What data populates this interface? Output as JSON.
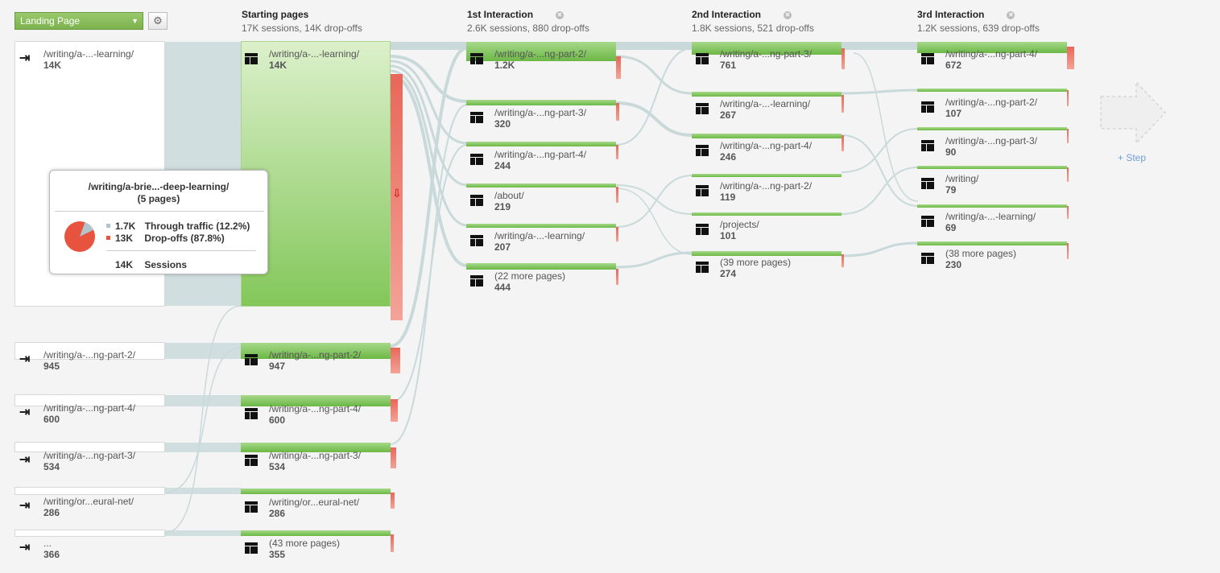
{
  "toolbar": {
    "dimension_select": "Landing Page",
    "settings_icon": "gear-icon"
  },
  "columns": [
    {
      "title": "Starting pages",
      "summary": "17K sessions, 14K drop-offs"
    },
    {
      "title": "1st Interaction",
      "summary": "2.6K sessions, 880 drop-offs"
    },
    {
      "title": "2nd Interaction",
      "summary": "1.8K sessions, 521 drop-offs"
    },
    {
      "title": "3rd Interaction",
      "summary": "1.2K sessions, 639 drop-offs"
    }
  ],
  "sources": [
    {
      "page": "/writing/a-...-learning/",
      "count": "14K"
    },
    {
      "page": "/writing/a-...ng-part-2/",
      "count": "945"
    },
    {
      "page": "/writing/a-...ng-part-4/",
      "count": "600"
    },
    {
      "page": "/writing/a-...ng-part-3/",
      "count": "534"
    },
    {
      "page": "/writing/or...eural-net/",
      "count": "286"
    },
    {
      "page": "...",
      "count": "366"
    }
  ],
  "starting_pages": [
    {
      "page": "/writing/a-...-learning/",
      "count": "14K"
    },
    {
      "page": "/writing/a-...ng-part-2/",
      "count": "947"
    },
    {
      "page": "/writing/a-...ng-part-4/",
      "count": "600"
    },
    {
      "page": "/writing/a-...ng-part-3/",
      "count": "534"
    },
    {
      "page": "/writing/or...eural-net/",
      "count": "286"
    },
    {
      "page": "(43 more pages)",
      "count": "355"
    }
  ],
  "interaction1": [
    {
      "page": "/writing/a-...ng-part-2/",
      "count": "1.2K"
    },
    {
      "page": "/writing/a-...ng-part-3/",
      "count": "320"
    },
    {
      "page": "/writing/a-...ng-part-4/",
      "count": "244"
    },
    {
      "page": "/about/",
      "count": "219"
    },
    {
      "page": "/writing/a-...-learning/",
      "count": "207"
    },
    {
      "page": "(22 more pages)",
      "count": "444"
    }
  ],
  "interaction2": [
    {
      "page": "/writing/a-...ng-part-3/",
      "count": "761"
    },
    {
      "page": "/writing/a-...-learning/",
      "count": "267"
    },
    {
      "page": "/writing/a-...ng-part-4/",
      "count": "246"
    },
    {
      "page": "/writing/a-...ng-part-2/",
      "count": "119"
    },
    {
      "page": "/projects/",
      "count": "101"
    },
    {
      "page": "(39 more pages)",
      "count": "274"
    }
  ],
  "interaction3": [
    {
      "page": "/writing/a-...ng-part-4/",
      "count": "672"
    },
    {
      "page": "/writing/a-...ng-part-2/",
      "count": "107"
    },
    {
      "page": "/writing/a-...ng-part-3/",
      "count": "90"
    },
    {
      "page": "/writing/",
      "count": "79"
    },
    {
      "page": "/writing/a-...-learning/",
      "count": "69"
    },
    {
      "page": "(38 more pages)",
      "count": "230"
    }
  ],
  "tooltip": {
    "title": "/writing/a-brie...-deep-learning/",
    "subtitle": "(5 pages)",
    "through_value": "1.7K",
    "through_label": "Through traffic (12.2%)",
    "dropoff_value": "13K",
    "dropoff_label": "Drop-offs (87.8%)",
    "sessions_value": "14K",
    "sessions_label": "Sessions",
    "through_fraction": 0.122,
    "colors": {
      "through": "#b0c4cc",
      "dropoff": "#e8533f"
    }
  },
  "add_step": "+ Step",
  "colors": {
    "accent_green": "#7cb24e",
    "dropoff_red": "#e8675a",
    "flow": "#c9d9da"
  }
}
